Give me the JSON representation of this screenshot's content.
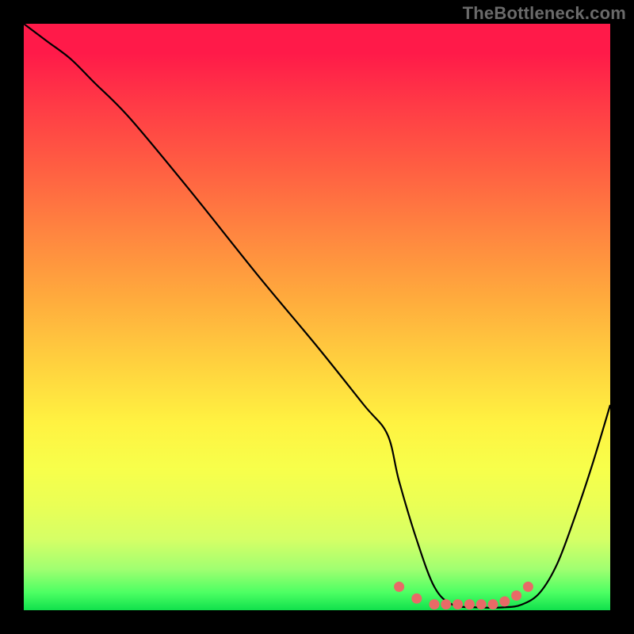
{
  "watermark": "TheBottleneck.com",
  "chart_data": {
    "type": "line",
    "title": "",
    "xlabel": "",
    "ylabel": "",
    "xlim": [
      0,
      100
    ],
    "ylim": [
      0,
      100
    ],
    "series": [
      {
        "name": "curve",
        "x": [
          0,
          4,
          8,
          12,
          18,
          28,
          40,
          50,
          58,
          62,
          64,
          67,
          70,
          73,
          77,
          82,
          85,
          88,
          91,
          94,
          97,
          100
        ],
        "y": [
          100,
          97,
          94,
          90,
          84,
          72,
          57,
          45,
          35,
          30,
          22,
          12,
          4,
          1,
          0.5,
          0.5,
          1,
          3,
          8,
          16,
          25,
          35
        ]
      },
      {
        "name": "dots",
        "x": [
          64,
          67,
          70,
          72,
          74,
          76,
          78,
          80,
          82,
          84,
          86
        ],
        "y": [
          4,
          2,
          1,
          1,
          1,
          1,
          1,
          1,
          1.5,
          2.5,
          4
        ]
      }
    ],
    "colors": {
      "curve": "#000000",
      "dots": "#e86a67",
      "gradient_top": "#ff1a49",
      "gradient_bottom": "#10e04c",
      "frame": "#000000"
    }
  }
}
